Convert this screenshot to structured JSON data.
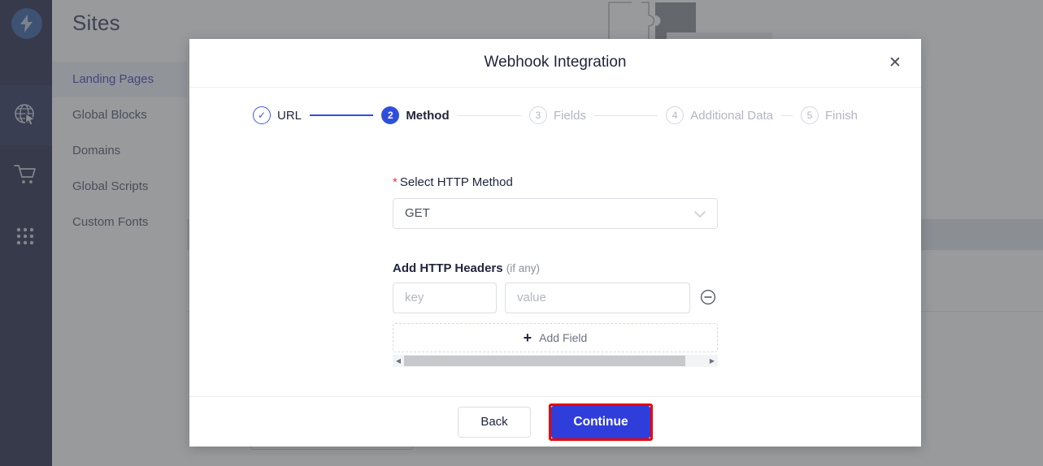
{
  "sidebar": {
    "logo_icon": "lightning-bolt-logo",
    "rail_items": [
      {
        "icon": "globe-cursor-icon",
        "active": true
      },
      {
        "icon": "shopping-cart-icon",
        "active": false
      },
      {
        "icon": "grid-apps-icon",
        "active": false
      }
    ],
    "title": "Sites",
    "items": [
      {
        "label": "Landing Pages",
        "active": true
      },
      {
        "label": "Global Blocks",
        "active": false
      },
      {
        "label": "Domains",
        "active": false
      },
      {
        "label": "Global Scripts",
        "active": false
      },
      {
        "label": "Custom Fonts",
        "active": false
      }
    ]
  },
  "background": {
    "puzzle_icon": "puzzle-piece-icon"
  },
  "modal": {
    "title": "Webhook Integration",
    "close_icon": "close-icon",
    "stepper": [
      {
        "marker": "✓",
        "label": "URL",
        "state": "done"
      },
      {
        "marker": "2",
        "label": "Method",
        "state": "current"
      },
      {
        "marker": "3",
        "label": "Fields",
        "state": "todo"
      },
      {
        "marker": "4",
        "label": "Additional Data",
        "state": "todo"
      },
      {
        "marker": "5",
        "label": "Finish",
        "state": "todo"
      }
    ],
    "method": {
      "required_marker": "*",
      "label": "Select HTTP Method",
      "value": "GET",
      "chevron_icon": "chevron-down-icon"
    },
    "headers": {
      "label": "Add HTTP Headers",
      "hint": "(if any)",
      "key_placeholder": "key",
      "value_placeholder": "value",
      "remove_icon": "minus-circle-icon",
      "add_field_label": "Add Field",
      "add_field_icon": "plus-icon"
    },
    "scrollbar": {
      "left_arrow": "◀",
      "right_arrow": "▶"
    },
    "footer": {
      "back_label": "Back",
      "continue_label": "Continue"
    }
  },
  "colors": {
    "accent_blue": "#2f4fdb",
    "continue_blue": "#2f3ddb",
    "highlight_red": "#ec0000",
    "required_red": "#e8323c",
    "sidebar_navy": "#0d1033",
    "nav_active": "#2b2fb0"
  }
}
